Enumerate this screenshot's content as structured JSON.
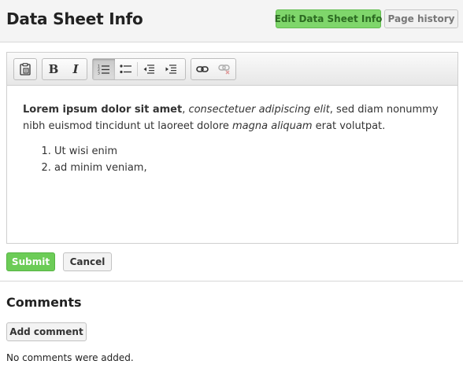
{
  "header": {
    "title": "Data Sheet Info",
    "edit_button": "Edit Data Sheet Info",
    "history_button": "Page history"
  },
  "toolbar": {
    "buttons": [
      {
        "icon": "paste-icon",
        "active": false
      },
      {
        "icon": "bold-icon",
        "glyph": "B",
        "active": false
      },
      {
        "icon": "italic-icon",
        "glyph": "I",
        "active": false
      },
      {
        "icon": "numbered-list-icon",
        "active": true
      },
      {
        "icon": "bulleted-list-icon",
        "active": false
      },
      {
        "icon": "outdent-icon",
        "active": false
      },
      {
        "icon": "indent-icon",
        "active": false
      },
      {
        "icon": "link-icon",
        "active": false
      },
      {
        "icon": "unlink-icon",
        "active": false,
        "disabled": true
      }
    ]
  },
  "editor": {
    "bold_text": "Lorem ipsum dolor sit amet",
    "comma": ", ",
    "italic_text": "consectetuer adipiscing elit",
    "mid_text": ", sed diam nonummy nibh euismod tincidunt ut laoreet dolore ",
    "italic_text_2": "magna aliquam",
    "end_text": " erat volutpat.",
    "list_items": [
      "Ut wisi enim",
      "ad minim veniam,"
    ]
  },
  "form": {
    "submit_label": "Submit",
    "cancel_label": "Cancel"
  },
  "comments": {
    "title": "Comments",
    "add_button": "Add comment",
    "empty_text": "No comments were added."
  },
  "colors": {
    "accent_green": "#7fd66b",
    "submit_green": "#6ccc57"
  }
}
